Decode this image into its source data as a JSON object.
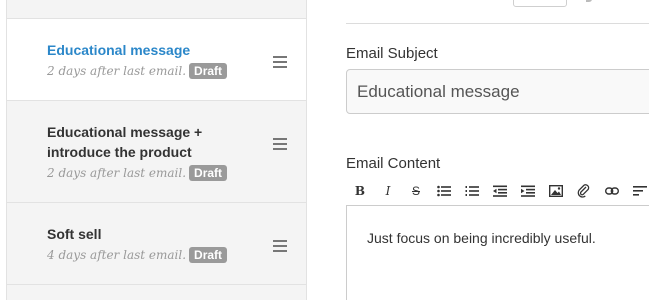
{
  "sequence": {
    "emails": [
      {
        "title": "Educational message",
        "timing": "2 days after last email.",
        "status": "Draft",
        "active": true
      },
      {
        "title": "Educational message + introduce the product",
        "timing": "2 days after last email.",
        "status": "Draft",
        "active": false
      },
      {
        "title": "Soft sell",
        "timing": "4 days after last email.",
        "status": "Draft",
        "active": false
      }
    ]
  },
  "editor": {
    "subject_label": "Email Subject",
    "subject_value": "Educational message",
    "content_label": "Email Content",
    "content_text": "Just focus on being incredibly useful.",
    "toolbar_icons": [
      "bold-icon",
      "italic-icon",
      "strikethrough-icon",
      "bullet-list-icon",
      "numbered-list-icon",
      "outdent-icon",
      "indent-icon",
      "image-icon",
      "attachment-icon",
      "link-icon",
      "align-icon"
    ]
  },
  "colors": {
    "active_title": "#2b87c9",
    "badge": "#9a9a9a",
    "sidebar_bg": "#f4f4f4"
  }
}
